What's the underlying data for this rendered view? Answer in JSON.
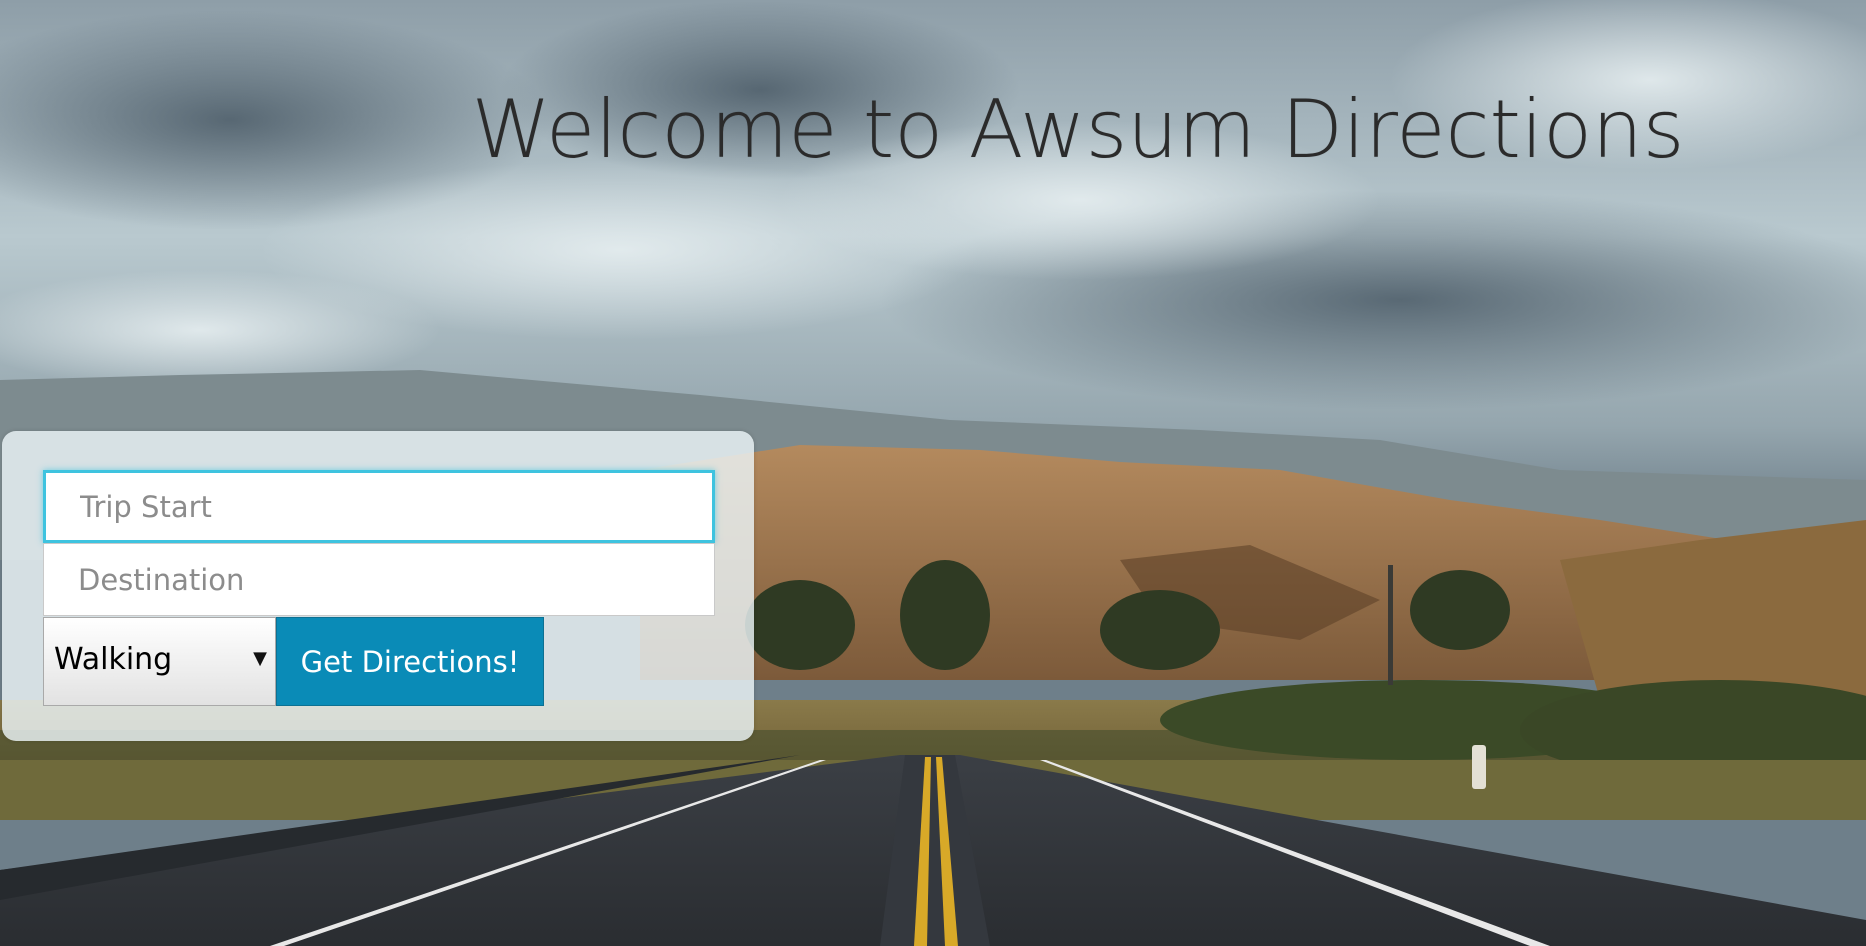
{
  "header": {
    "title": "Welcome to Awsum Directions"
  },
  "form": {
    "start": {
      "placeholder": "Trip Start",
      "value": ""
    },
    "destination": {
      "placeholder": "Destination",
      "value": ""
    },
    "mode": {
      "selected": "Walking"
    },
    "submit_label": "Get Directions!"
  },
  "icons": {
    "dropdown": "chevron-down-icon"
  },
  "colors": {
    "button": "#0a8bb7",
    "focus_ring": "#3ec3df",
    "title": "#2b2b2b"
  }
}
